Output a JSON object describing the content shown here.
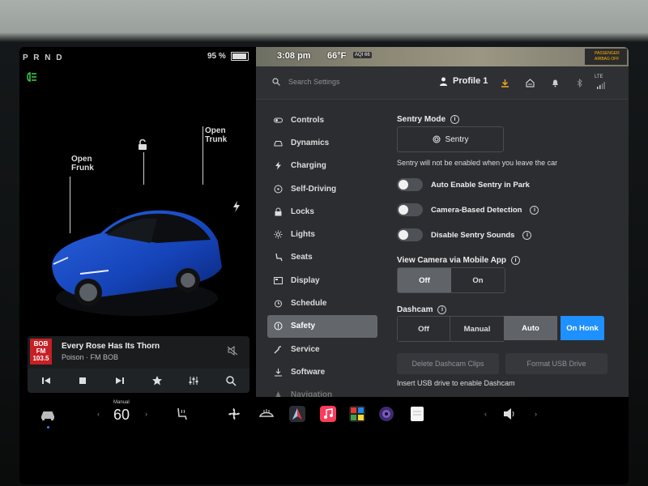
{
  "status": {
    "gear": "P R N D",
    "battery": "95 %",
    "battery_level": 0.95
  },
  "car": {
    "frunk_label": "Open\nFrunk",
    "trunk_label": "Open\nTrunk"
  },
  "media": {
    "logo": "BOB FM 103.5",
    "song": "Every Rose Has Its Thorn",
    "station": "Poison · FM BOB"
  },
  "map": {
    "time": "3:08 pm",
    "temp": "66°F",
    "aqi": "AQI 66",
    "airbag": "PASSENGER AIRBAG OFF"
  },
  "topbar": {
    "search_placeholder": "Search Settings",
    "profile": "Profile 1",
    "cell": "LTE"
  },
  "nav": [
    {
      "label": "Controls",
      "icon": "toggle-icon"
    },
    {
      "label": "Dynamics",
      "icon": "car-icon"
    },
    {
      "label": "Charging",
      "icon": "bolt-icon"
    },
    {
      "label": "Self-Driving",
      "icon": "steering-wheel-icon"
    },
    {
      "label": "Locks",
      "icon": "lock-icon"
    },
    {
      "label": "Lights",
      "icon": "sun-icon"
    },
    {
      "label": "Seats",
      "icon": "seat-icon"
    },
    {
      "label": "Display",
      "icon": "display-icon"
    },
    {
      "label": "Schedule",
      "icon": "clock-icon"
    },
    {
      "label": "Safety",
      "icon": "shield-icon"
    },
    {
      "label": "Service",
      "icon": "wrench-icon"
    },
    {
      "label": "Software",
      "icon": "download-icon"
    },
    {
      "label": "Navigation",
      "icon": "navigation-icon"
    }
  ],
  "safety": {
    "sentry_mode_label": "Sentry Mode",
    "sentry_button": "Sentry",
    "sentry_note": "Sentry will not be enabled when you leave the car",
    "toggles": [
      {
        "label": "Auto Enable Sentry in Park",
        "info": false
      },
      {
        "label": "Camera-Based Detection",
        "info": true
      },
      {
        "label": "Disable Sentry Sounds",
        "info": true
      }
    ],
    "view_camera_label": "View Camera via Mobile App",
    "view_camera_options": [
      "Off",
      "On"
    ],
    "dashcam_label": "Dashcam",
    "dashcam_options": [
      "Off",
      "Manual",
      "Auto",
      "On Honk"
    ],
    "delete_clips": "Delete Dashcam Clips",
    "format_usb": "Format USB Drive",
    "usb_note": "Insert USB drive to enable Dashcam"
  },
  "dock": {
    "temp_mode": "Manual",
    "temp": "60"
  }
}
